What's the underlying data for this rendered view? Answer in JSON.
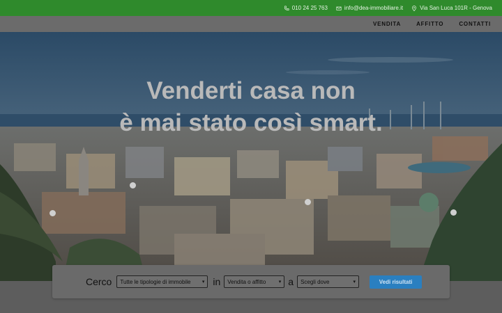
{
  "topbar": {
    "phone": "010 24 25 763",
    "email": "info@dea-immobiliare.it",
    "address": "Via San Luca 101R - Genova"
  },
  "nav": {
    "items": [
      "VENDITA",
      "AFFITTO",
      "CONTATTI"
    ]
  },
  "hero": {
    "title_line1": "Venderti casa non",
    "title_line2": "è mai stato così smart."
  },
  "search": {
    "label_cerco": "Cerco",
    "type_select": "Tutte le tipologie di immobile",
    "label_in": "in",
    "contract_select": "Vendita o affitto",
    "label_a": "a",
    "location_select": "Scegli dove",
    "button": "Vedi risultati"
  },
  "colors": {
    "topbar": "#2f8a2c",
    "button": "#2a7fc0"
  }
}
